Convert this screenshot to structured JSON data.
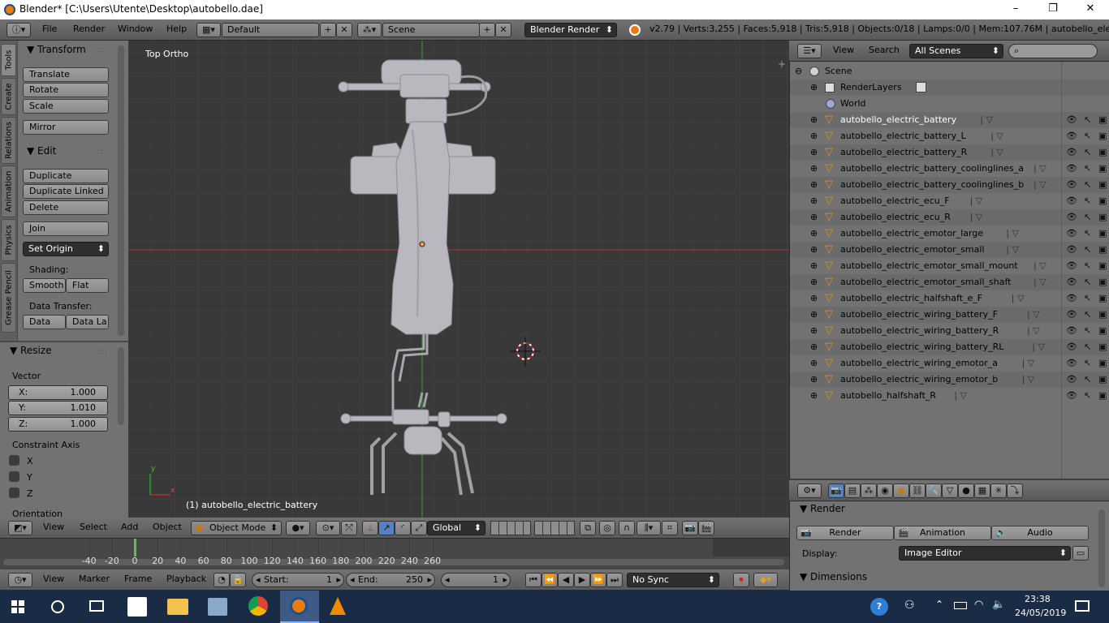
{
  "window": {
    "title": "Blender* [C:\\Users\\Utente\\Desktop\\autobello.dae]",
    "minimize": "–",
    "maximize": "❐",
    "close": "✕"
  },
  "topbar": {
    "menus": [
      "File",
      "Render",
      "Window",
      "Help"
    ],
    "screen_layout": "Default",
    "scene": "Scene",
    "engine": "Blender Render",
    "stats": "v2.79 | Verts:3,255 | Faces:5,918 | Tris:5,918 | Objects:0/18 | Lamps:0/0 | Mem:107.76M | autobello_electric_ban"
  },
  "tool_tabs": [
    "Tools",
    "Create",
    "Relations",
    "Animation",
    "Physics",
    "Grease Pencil"
  ],
  "toolshelf": {
    "transform_title": "Transform",
    "transform_buttons": [
      "Translate",
      "Rotate",
      "Scale"
    ],
    "mirror": "Mirror",
    "edit_title": "Edit",
    "edit_buttons": [
      "Duplicate",
      "Duplicate Linked",
      "Delete"
    ],
    "join": "Join",
    "set_origin": "Set Origin",
    "shading_label": "Shading:",
    "smooth": "Smooth",
    "flat": "Flat",
    "data_transfer_label": "Data Transfer:",
    "data": "Data",
    "data_la": "Data La"
  },
  "operator": {
    "title": "Resize",
    "vector_label": "Vector",
    "x_label": "X:",
    "x": "1.000",
    "y_label": "Y:",
    "y": "1.010",
    "z_label": "Z:",
    "z": "1.000",
    "constraint_label": "Constraint Axis",
    "cx": "X",
    "cy": "Y",
    "cz": "Z",
    "orientation_label": "Orientation"
  },
  "viewport": {
    "view_name": "Top Ortho",
    "active_object": "(1) autobello_electric_battery",
    "axis_x": "x",
    "axis_y": "y"
  },
  "viewport_header": {
    "menus": [
      "View",
      "Select",
      "Add",
      "Object"
    ],
    "mode": "Object Mode",
    "orientation": "Global"
  },
  "timeline": {
    "ticks": [
      "-40",
      "-20",
      "0",
      "20",
      "40",
      "60",
      "80",
      "100",
      "120",
      "140",
      "160",
      "180",
      "200",
      "220",
      "240",
      "260"
    ],
    "current_frame_value": 0
  },
  "timeline_header": {
    "menus": [
      "View",
      "Marker",
      "Frame",
      "Playback"
    ],
    "start_label": "Start:",
    "start": "1",
    "end_label": "End:",
    "end": "250",
    "current": "1",
    "sync": "No Sync"
  },
  "outliner_header": {
    "view": "View",
    "search": "Search",
    "filter": "All Scenes"
  },
  "outliner": {
    "scene": "Scene",
    "render_layers": "RenderLayers",
    "world": "World",
    "objects": [
      "autobello_electric_battery",
      "autobello_electric_battery_L",
      "autobello_electric_battery_R",
      "autobello_electric_battery_coolinglines_a",
      "autobello_electric_battery_coolinglines_b",
      "autobello_electric_ecu_F",
      "autobello_electric_ecu_R",
      "autobello_electric_emotor_large",
      "autobello_electric_emotor_small",
      "autobello_electric_emotor_small_mount",
      "autobello_electric_emotor_small_shaft",
      "autobello_electric_halfshaft_e_F",
      "autobello_electric_wiring_battery_F",
      "autobello_electric_wiring_battery_R",
      "autobello_electric_wiring_battery_RL",
      "autobello_electric_wiring_emotor_a",
      "autobello_electric_wiring_emotor_b",
      "autobello_halfshaft_R"
    ]
  },
  "properties": {
    "render_title": "Render",
    "render_btn": "Render",
    "animation_btn": "Animation",
    "audio_btn": "Audio",
    "display_label": "Display:",
    "display_value": "Image Editor",
    "dimensions_title": "Dimensions"
  },
  "taskbar": {
    "time": "23:38",
    "date": "24/05/2019"
  },
  "colors": {
    "accent_orange": "#e98a1f",
    "selection_orange": "#f0a040",
    "axis_red": "#b03030",
    "axis_green": "#2e9e2e"
  }
}
